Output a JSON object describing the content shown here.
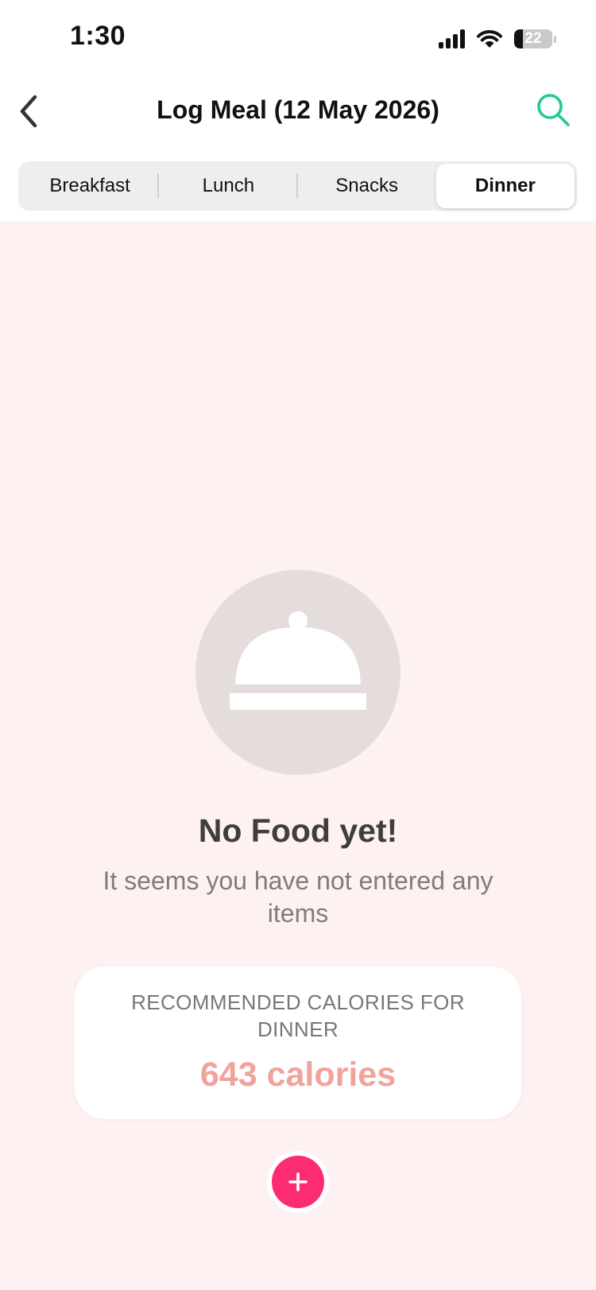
{
  "status_bar": {
    "time": "1:30",
    "battery_percent": "22",
    "battery_level": 0.22,
    "signal_icon": "cellular-signal-icon",
    "wifi_icon": "wifi-icon",
    "battery_icon": "battery-icon"
  },
  "nav": {
    "title": "Log Meal (12 May 2026)",
    "back_icon": "chevron-left-icon",
    "search_icon": "search-icon"
  },
  "meal_tabs": {
    "items": [
      "Breakfast",
      "Lunch",
      "Snacks",
      "Dinner"
    ],
    "selected": "Dinner"
  },
  "empty_state": {
    "icon": "food-cloche-icon",
    "title": "No Food yet!",
    "subtitle": "It seems you have not entered any items"
  },
  "recommendation": {
    "label": "RECOMMENDED CALORIES FOR DINNER",
    "value": "643 calories"
  },
  "add_button": {
    "icon": "plus-icon"
  },
  "colors": {
    "accent_search": "#20c997",
    "content_background": "#fdf2f1",
    "calories_value": "#f0a39b",
    "add_button": "#fb2c73",
    "illustration_circle": "#e4dddc"
  }
}
